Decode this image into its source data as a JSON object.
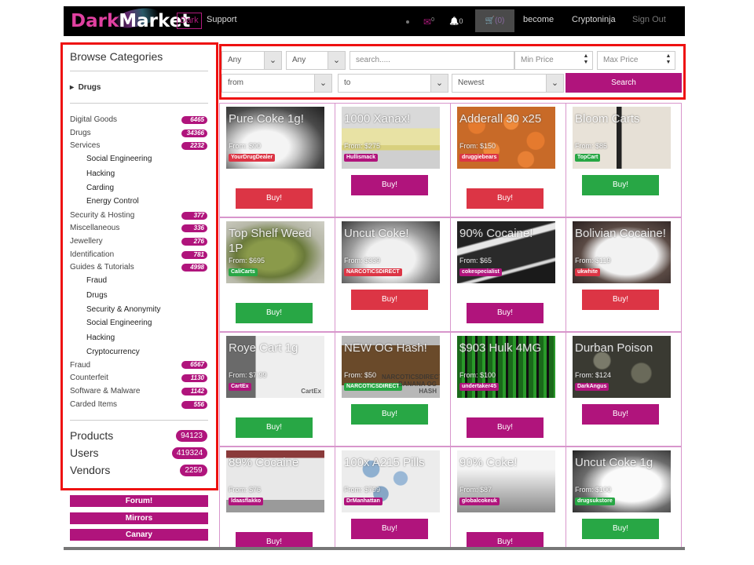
{
  "header": {
    "logo_part1": "Dark",
    "logo_part2": "Market",
    "dark_toggle": "Dark",
    "support": "Support",
    "mail_icon": "✉",
    "mail_count": "0",
    "bell_icon": "🔔",
    "bell_count": "0",
    "cart_label": "(0)",
    "become": "become",
    "username": "Cryptoninja",
    "signout": "Sign Out"
  },
  "sidebar": {
    "title": "Browse Categories",
    "drugs_toggle": "Drugs",
    "categories": [
      {
        "label": "Digital Goods",
        "count": "6465"
      },
      {
        "label": "Drugs",
        "count": "34366"
      },
      {
        "label": "Services",
        "count": "2232"
      },
      {
        "label": "Social Engineering"
      },
      {
        "label": "Hacking"
      },
      {
        "label": "Carding"
      },
      {
        "label": "Energy Control"
      },
      {
        "label": "Security & Hosting",
        "count": "377"
      },
      {
        "label": "Miscellaneous",
        "count": "336"
      },
      {
        "label": "Jewellery",
        "count": "276"
      },
      {
        "label": "Identification",
        "count": "781"
      },
      {
        "label": "Guides & Tutorials",
        "count": "4998"
      },
      {
        "label": "Fraud"
      },
      {
        "label": "Drugs"
      },
      {
        "label": "Security & Anonymity"
      },
      {
        "label": "Social Engineering"
      },
      {
        "label": "Hacking"
      },
      {
        "label": "Cryptocurrency"
      },
      {
        "label": "Fraud",
        "count": "6567"
      },
      {
        "label": "Counterfeit",
        "count": "1130"
      },
      {
        "label": "Software & Malware",
        "count": "1142"
      },
      {
        "label": "Carded Items",
        "count": "556"
      }
    ],
    "stats": [
      {
        "label": "Products",
        "count": "94123"
      },
      {
        "label": "Users",
        "count": "419324"
      },
      {
        "label": "Vendors",
        "count": "2259"
      }
    ],
    "buttons": [
      "Forum!",
      "Mirrors",
      "Canary"
    ]
  },
  "filters": {
    "select1": "Any",
    "select2": "Any",
    "search_placeholder": "search.....",
    "min_price_placeholder": "Min Price",
    "max_price_placeholder": "Max Price",
    "from": "from",
    "to": "to",
    "sort": "Newest",
    "search_button": "Search"
  },
  "colors": {
    "brand": "#b0147c",
    "buy_red": "#dc3545",
    "buy_green": "#28a745",
    "highlight_box": "#ee1111"
  },
  "products": [
    {
      "title": "Pure Coke 1g!",
      "price": "From: $90",
      "vendor": "YourDrugDealer",
      "tag_color": "#dc3545",
      "buy": "Buy!",
      "buy_color": "#dc3545",
      "image": "coke-photo"
    },
    {
      "title": "1000 Xanax!",
      "price": "From: $275",
      "vendor": "Hullismack",
      "tag_color": "#b0147c",
      "buy": "Buy!",
      "buy_color": "#b0147c",
      "image": "pills-photo"
    },
    {
      "title": "Adderall 30 x25",
      "price": "From: $150",
      "vendor": "druggiebears",
      "tag_color": "#dc3545",
      "buy": "Buy!",
      "buy_color": "#dc3545",
      "image": "orange-pills-photo"
    },
    {
      "title": "Bloom Carts",
      "price": "From: $85",
      "vendor": "TopCart",
      "tag_color": "#28a745",
      "buy": "Buy!",
      "buy_color": "#28a745",
      "image": "carts-photo"
    },
    {
      "title": "Top Shelf Weed 1P",
      "price": "From: $695",
      "vendor": "CaliCarts",
      "tag_color": "#28a745",
      "buy": "Buy!",
      "buy_color": "#28a745",
      "image": "weed-photo"
    },
    {
      "title": "Uncut Coke!",
      "price": "From: $339",
      "vendor": "NARCOTICSDIRECT",
      "tag_color": "#dc3545",
      "buy": "Buy!",
      "buy_color": "#dc3545",
      "image": "coke-bag-photo"
    },
    {
      "title": "90% Cocaine!",
      "price": "From: $65",
      "vendor": "cokespecialist",
      "tag_color": "#b0147c",
      "buy": "Buy!",
      "buy_color": "#b0147c",
      "image": "coke-line-photo"
    },
    {
      "title": "Bolivian Cocaine!",
      "price": "From: $119",
      "vendor": "ukwhite",
      "tag_color": "#dc3545",
      "buy": "Buy!",
      "buy_color": "#dc3545",
      "image": "coke-plate-photo"
    },
    {
      "title": "Roye Cart 1g",
      "price": "From: $7.99",
      "vendor": "CartEx",
      "tag_color": "#b0147c",
      "buy": "Buy!",
      "buy_color": "#28a745",
      "image": "cart-box-photo",
      "image_text": "CartEx"
    },
    {
      "title": "NEW OG Hash!",
      "price": "From: $50",
      "vendor": "NARCOTICSDIRECT",
      "tag_color": "#28a745",
      "buy": "Buy!",
      "buy_color": "#28a745",
      "image": "hash-photo",
      "image_text": "NARCOTICSDIRECT BANANA OG HASH"
    },
    {
      "title": "$903 Hulk 4MG",
      "price": "From: $100",
      "vendor": "undertaker45",
      "tag_color": "#b0147c",
      "buy": "Buy!",
      "buy_color": "#b0147c",
      "image": "hulk-photo"
    },
    {
      "title": "Durban Poison",
      "price": "From: $124",
      "vendor": "DarkAngus",
      "tag_color": "#b0147c",
      "buy": "Buy!",
      "buy_color": "#b0147c",
      "image": "durban-photo"
    },
    {
      "title": "89% Cocaine",
      "price": "From: $76",
      "vendor": "ldaasflakko",
      "tag_color": "#b0147c",
      "buy": "Buy!",
      "buy_color": "#b0147c",
      "image": "coke-bag2-photo"
    },
    {
      "title": "100x A215 Pills",
      "price": "From: $799",
      "vendor": "DrManhattan",
      "tag_color": "#b0147c",
      "buy": "Buy!",
      "buy_color": "#b0147c",
      "image": "blue-pills-photo"
    },
    {
      "title": "90% Coke!",
      "price": "From: $87",
      "vendor": "globalcokeuk",
      "tag_color": "#b0147c",
      "buy": "Buy!",
      "buy_color": "#b0147c",
      "image": "coke3-photo"
    },
    {
      "title": "Uncut Coke 1g",
      "price": "From: $100",
      "vendor": "drugsukstore",
      "tag_color": "#28a745",
      "buy": "Buy!",
      "buy_color": "#28a745",
      "image": "coke4-photo"
    }
  ]
}
